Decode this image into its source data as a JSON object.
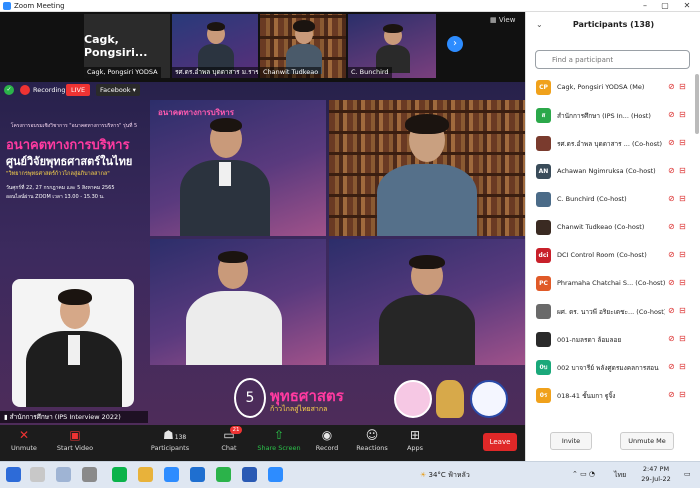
{
  "window": {
    "title": "Zoom Meeting"
  },
  "strip": {
    "tiles": [
      {
        "name": "Cagk,  Pongsiri YODSA",
        "label": "Cagk,  Pongsiri..."
      },
      {
        "name": "รศ.ดร.อำพล บุดดาสาร ม.ราช..."
      },
      {
        "name": "Chanwit Tudkeao"
      },
      {
        "name": "C. Bunchird"
      }
    ],
    "view_label": "View"
  },
  "status": {
    "recording": "Recording",
    "live": "LIVE",
    "stream": "Facebook"
  },
  "poster": {
    "header": "โครงการอบรมเชิงวิชาการ \"อนาคตทางการบริหาร\" รุ่นที่ 5",
    "title_line1": "อนาคตทางการบริหาร",
    "title_line2": "ศูนย์วิจัยพุทธศาสตร์ในไทย",
    "subtitle": "\"วิทยากรพุทธศาสตร์ก้าวไกลสู่อภิบาลสากล\"",
    "date": "วันศุกร์ที่ 22, 27 กรกฎาคม และ 5 สิงหาคม 2565",
    "time": "ออนไลน์ผ่าน ZOOM  เวลา 13.00 - 15.30 น."
  },
  "banner": {
    "title": "พุทธศาสตร",
    "subtitle": "ก้าวไกลสู่ไทยสากล",
    "number": "5"
  },
  "self_view": {
    "name": "สำนักการศึกษา (IPS Interview 2022)"
  },
  "controls": {
    "unmute": "Unmute",
    "start_video": "Start Video",
    "participants": "Participants",
    "participants_count": "138",
    "chat": "Chat",
    "chat_badge": "21",
    "share": "Share Screen",
    "record": "Record",
    "reactions": "Reactions",
    "apps": "Apps",
    "leave": "Leave"
  },
  "panel": {
    "title": "Participants (138)",
    "search_placeholder": "Find a participant",
    "participants": [
      {
        "initials": "CP",
        "color": "#f0a11b",
        "name": "Cagk, Pongsiri YODSA (Me)"
      },
      {
        "initials": "ส",
        "color": "#2ba84a",
        "name": "สำนักการศึกษา (IPS In...  (Host)"
      },
      {
        "initials": "",
        "color": "#7a3b2e",
        "name": "รศ.ดร.อำพล บุดดาสาร ...  (Co-host)"
      },
      {
        "initials": "AN",
        "color": "#3a4c5a",
        "name": "Achawan Ngimruksa (Co-host)"
      },
      {
        "initials": "",
        "color": "#4b6b88",
        "name": "C. Bunchird (Co-host)"
      },
      {
        "initials": "",
        "color": "#3a2a22",
        "name": "Chanwit Tudkeao (Co-host)"
      },
      {
        "initials": "dci",
        "color": "#c8202a",
        "name": "DCI Control Room (Co-host)"
      },
      {
        "initials": "PC",
        "color": "#e05a28",
        "name": "Phramaha Chatchai S...  (Co-host)"
      },
      {
        "initials": "",
        "color": "#6a6a6a",
        "name": "ผศ. ดร. นาวพี อริยะเดชะ...  (Co-host)"
      },
      {
        "initials": "",
        "color": "#2a2a2a",
        "name": "001-กมลรดา ล้อมลอย"
      },
      {
        "initials": "0บ",
        "color": "#1aa87a",
        "name": "002 บาจารีย์ พลังศูดรมงคลการสอน"
      },
      {
        "initials": "0ร",
        "color": "#f0a11b",
        "name": "018-41 ชั้นมกา ฐูจิ้ง"
      }
    ],
    "invite": "Invite",
    "unmute_me": "Unmute Me"
  },
  "taskbar": {
    "weather": "34°C",
    "weather_text": "ฟ้าหลัว",
    "lang": "ไทย",
    "time": "2:47 PM",
    "date": "29-Jul-22"
  }
}
